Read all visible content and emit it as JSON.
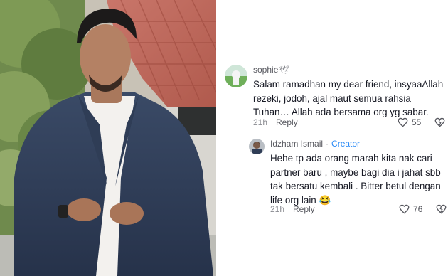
{
  "comments": [
    {
      "author": "sophie",
      "badge_icon": "dove-icon",
      "text": "Salam ramadhan my dear friend, insyaaAllah rezeki, jodoh, ajal maut semua rahsia Tuhan… Allah ada bersama org yg sabar.",
      "time": "21h",
      "reply_label": "Reply",
      "likes": "55"
    },
    {
      "author": "Idzham Ismail",
      "separator": "·",
      "role": "Creator",
      "text": "Hehe tp ada orang marah kita nak cari partner baru , maybe bagi dia i jahat sbb tak bersatu kembali . Bitter betul dengan life org lain 😂",
      "time": "21h",
      "reply_label": "Reply",
      "likes": "76"
    }
  ],
  "colors": {
    "creator": "#2a8af6",
    "text": "#161823",
    "muted": "#8a8b91"
  }
}
